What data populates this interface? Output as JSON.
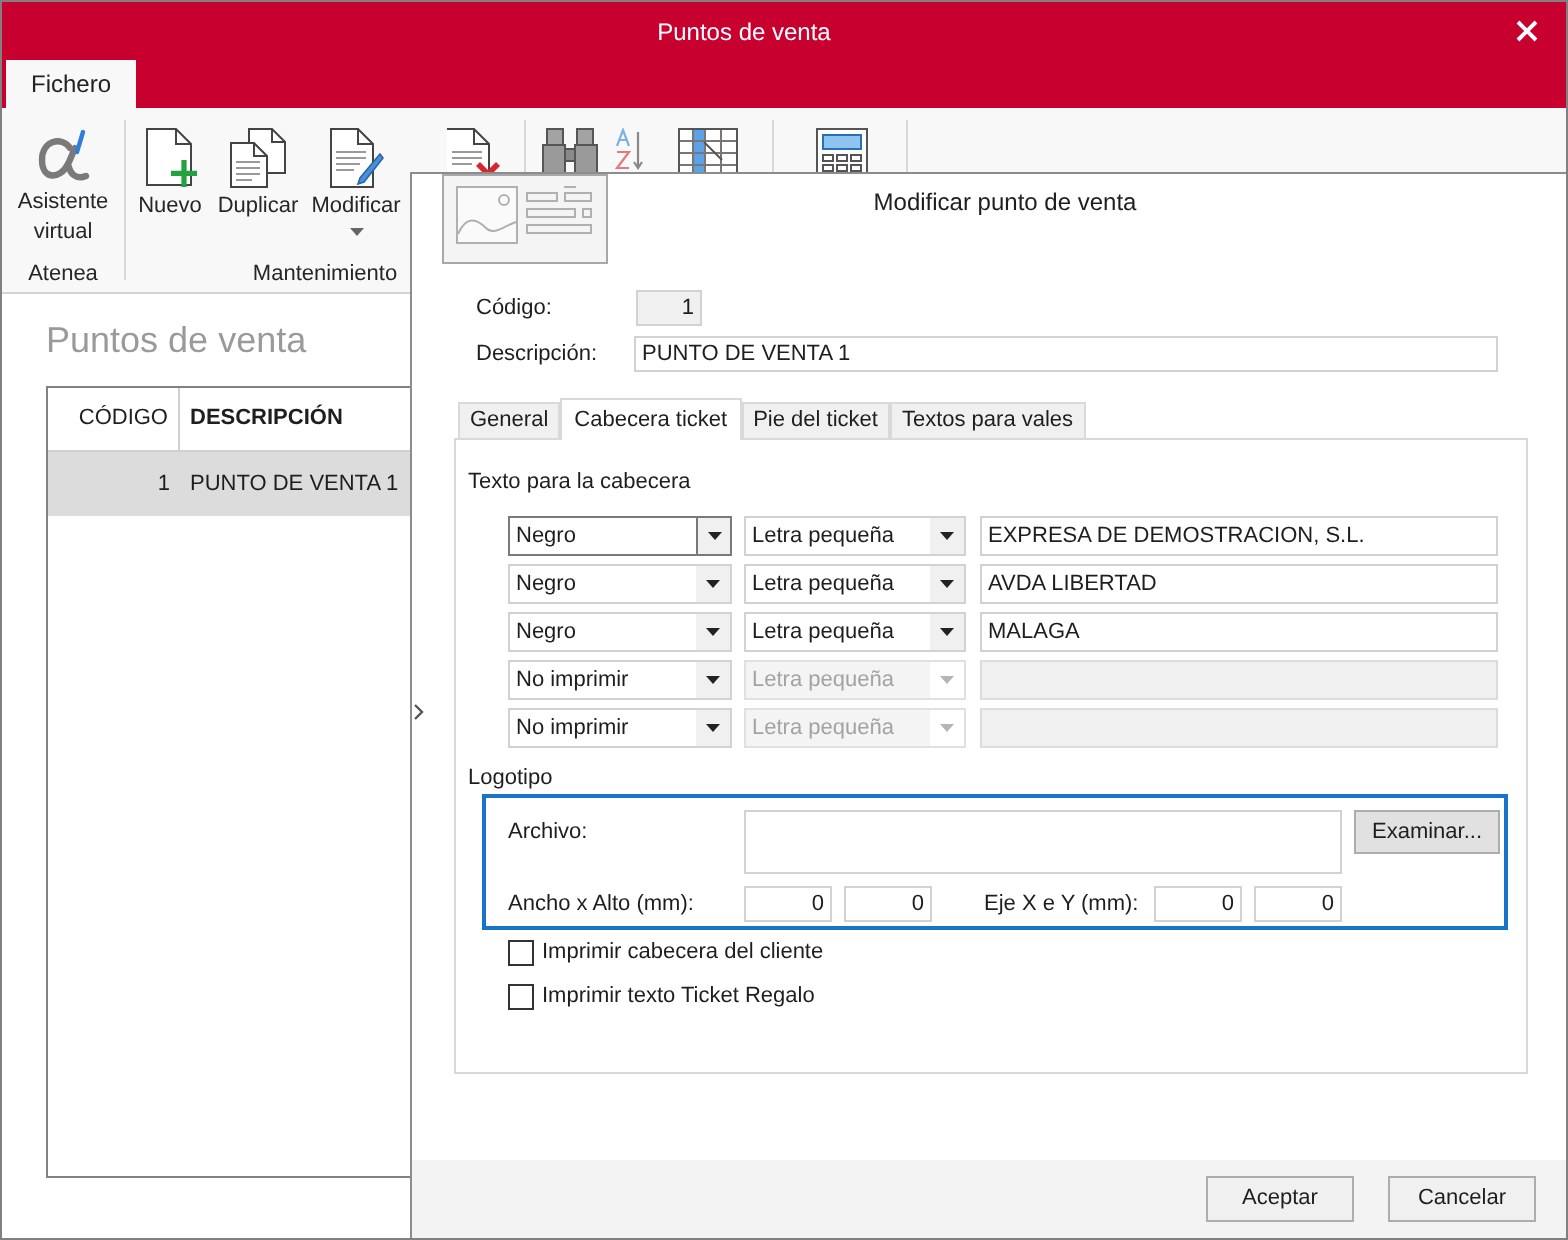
{
  "window": {
    "title": "Puntos de venta"
  },
  "ribbon_tabs": [
    {
      "label": "Fichero",
      "selected": true
    }
  ],
  "ribbon_groups": [
    {
      "label": "Atenea",
      "buttons": [
        {
          "kind": "assistant",
          "label": "Asistente virtual",
          "menu": false
        }
      ]
    },
    {
      "label": "Mantenimiento",
      "buttons": [
        {
          "kind": "new",
          "label": "Nuevo",
          "menu": false
        },
        {
          "kind": "duplicate",
          "label": "Duplicar",
          "menu": false
        },
        {
          "kind": "edit",
          "label": "Modificar",
          "menu": true
        },
        {
          "kind": "delete"
        }
      ]
    },
    {
      "buttons": [
        {
          "kind": "search"
        },
        {
          "kind": "sort"
        },
        {
          "kind": "grid"
        }
      ]
    },
    {
      "buttons": [
        {
          "kind": "calculator"
        }
      ]
    }
  ],
  "page_title": "Puntos de venta",
  "table": {
    "columns": [
      "CÓDIGO",
      "DESCRIPCIÓN"
    ],
    "rows": [
      {
        "cells": [
          "1",
          "PUNTO DE VENTA 1"
        ],
        "selected": true
      }
    ]
  },
  "dialog": {
    "title": "Modificar punto de venta",
    "fields": [
      {
        "label": "Código:",
        "value": "1",
        "disabled": true
      },
      {
        "label": "Descripción:",
        "value": "PUNTO DE VENTA 1",
        "disabled": false
      }
    ],
    "tabs": [
      {
        "label": "General",
        "selected": false
      },
      {
        "label": "Cabecera ticket",
        "selected": true
      },
      {
        "label": "Pie del ticket",
        "selected": false
      },
      {
        "label": "Textos para vales",
        "selected": false
      }
    ],
    "header_text": {
      "label": "Texto para la cabecera",
      "lines": [
        {
          "ink_option": "Negro",
          "size_option": "Letra pequeña",
          "text": "EXPRESA DE DEMOSTRACION, S.L.",
          "focused": true,
          "disabled": false
        },
        {
          "ink_option": "Negro",
          "size_option": "Letra pequeña",
          "text": "AVDA LIBERTAD",
          "focused": false,
          "disabled": false
        },
        {
          "ink_option": "Negro",
          "size_option": "Letra pequeña",
          "text": "MALAGA",
          "focused": false,
          "disabled": false
        },
        {
          "ink_option": "No imprimir",
          "size_option": "Letra pequeña",
          "focused": false,
          "disabled": true
        },
        {
          "ink_option": "No imprimir",
          "size_option": "Letra pequeña",
          "focused": false,
          "disabled": true
        }
      ]
    },
    "logo": {
      "label": "Logotipo",
      "highlighted": true,
      "file_label": "Archivo:",
      "browse_button": "Examinar...",
      "size_label": "Ancho x Alto (mm):",
      "size_values": [
        "0",
        "0"
      ],
      "offset_label": "Eje X e Y (mm):",
      "offset_values": [
        "0",
        "0"
      ]
    },
    "checkboxes": [
      {
        "label": "Imprimir cabecera del cliente",
        "checked": false
      },
      {
        "label": "Imprimir texto Ticket Regalo",
        "checked": false
      }
    ],
    "buttons": [
      "Aceptar",
      "Cancelar"
    ]
  }
}
